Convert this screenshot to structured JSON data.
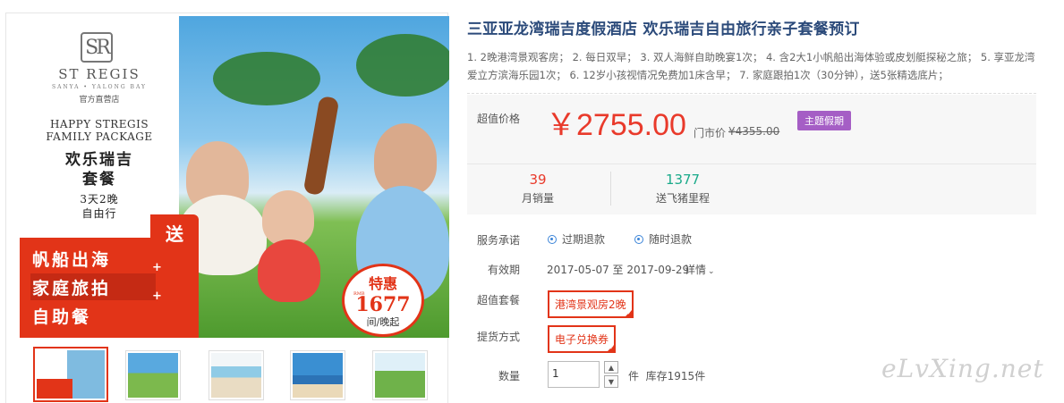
{
  "product": {
    "title": "三亚亚龙湾瑞吉度假酒店 欢乐瑞吉自由旅行亲子套餐预订",
    "description": "1. 2晚港湾景观客房； 2. 每日双早； 3. 双人海鲜自助晚宴1次； 4. 含2大1小帆船出海体验或皮划艇探秘之旅； 5. 享亚龙湾爱立方滨海乐园1次； 6. 12岁小孩视情况免费加1床含早； 7. 家庭跟拍1次（30分钟），送5张精选底片；"
  },
  "hero": {
    "logo_mark": "SR",
    "brand_name": "ST REGIS",
    "brand_location": "SANYA • YALONG BAY",
    "brand_store": "官方直营店",
    "pkg_en_1": "HAPPY STREGIS",
    "pkg_en_2": "FAMILY PACKAGE",
    "pkg_cn_1": "欢乐瑞吉",
    "pkg_cn_2": "套餐",
    "pkg_days": "3天2晚",
    "pkg_type": "自由行",
    "send_label": "送",
    "perk_1": "帆船出海",
    "perk_2": "家庭旅拍",
    "perk_3": "自助餐",
    "plus": "+",
    "badge_title": "特惠",
    "badge_currency": "RMB",
    "badge_price": "1677",
    "badge_unit": "间/晚起"
  },
  "thumbnails": [
    {
      "name": "thumb-1",
      "selected": true
    },
    {
      "name": "thumb-2",
      "selected": false
    },
    {
      "name": "thumb-3",
      "selected": false
    },
    {
      "name": "thumb-4",
      "selected": false
    },
    {
      "name": "thumb-5",
      "selected": false
    }
  ],
  "pricing": {
    "label": "超值价格",
    "price": "￥2755.00",
    "market_label": "门市价",
    "market_price": "¥4355.00",
    "tag": "主题假期"
  },
  "stats": {
    "sales_value": "39",
    "sales_label": "月销量",
    "miles_value": "1377",
    "miles_label": "送飞猪里程"
  },
  "service": {
    "label": "服务承诺",
    "items": [
      "过期退款",
      "随时退款"
    ]
  },
  "validity": {
    "label": "有效期",
    "range": "2017-05-07 至 2017-09-29",
    "detail": "详情",
    "detail_icon": "chevron-down-icon"
  },
  "package": {
    "label": "超值套餐",
    "option": "港湾景观房2晚"
  },
  "delivery": {
    "label": "提货方式",
    "option": "电子兑换券"
  },
  "quantity": {
    "label": "数量",
    "value": "1",
    "unit": "件",
    "stock": "库存1915件"
  },
  "watermark": "eLvXing.net",
  "colors": {
    "accent_red": "#e93a2b",
    "title_blue": "#2b4a7a",
    "tag_purple": "#a55ec5",
    "miles_green": "#1aaa8a"
  }
}
